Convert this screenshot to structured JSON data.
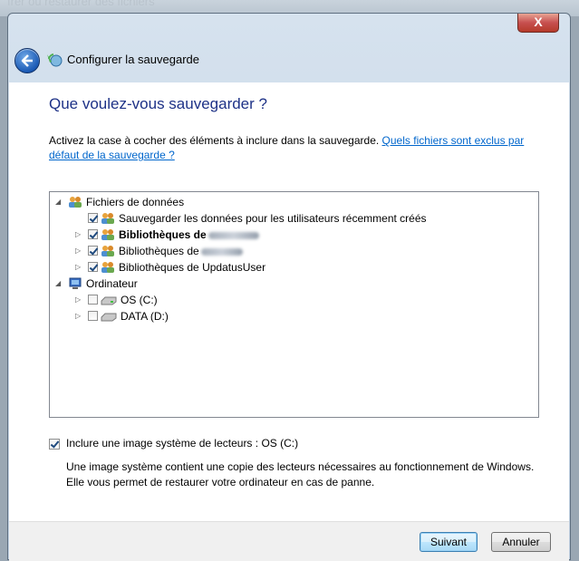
{
  "background": {
    "title_fragment": "ırer ou restaurer des fichiers"
  },
  "window": {
    "title": "Configurer la sauvegarde",
    "close_label": "X",
    "accent": "#1e3287",
    "link_color": "#0066cc"
  },
  "content": {
    "heading": "Que voulez-vous sauvegarder ?",
    "description": "Activez la case à cocher des éléments à inclure dans la sauvegarde.",
    "link_text": "Quels fichiers sont exclus par défaut de la sauvegarde ?"
  },
  "tree": {
    "data_files": {
      "label": "Fichiers de données",
      "icon": "users-icon",
      "expanded": true,
      "children": [
        {
          "label": "Sauvegarder les données pour les utilisateurs récemment créés",
          "checked": true,
          "icon": "users-icon"
        },
        {
          "label": "Bibliothèques de",
          "checked": true,
          "icon": "users-icon",
          "bold": true,
          "redacted": true
        },
        {
          "label": "Bibliothèques de",
          "checked": true,
          "icon": "users-icon",
          "redacted": true
        },
        {
          "label": "Bibliothèques de UpdatusUser",
          "checked": true,
          "icon": "users-icon"
        }
      ]
    },
    "computer": {
      "label": "Ordinateur",
      "icon": "computer-icon",
      "expanded": true,
      "children": [
        {
          "label": "OS (C:)",
          "checked": false,
          "icon": "drive-icon"
        },
        {
          "label": "DATA (D:)",
          "checked": false,
          "icon": "drive-icon"
        }
      ]
    }
  },
  "system_image": {
    "checked": true,
    "label": "Inclure une image système de lecteurs : OS (C:)",
    "description": "Une image système contient une copie des lecteurs nécessaires au fonctionnement de Windows. Elle vous permet de restaurer votre ordinateur en cas de panne."
  },
  "buttons": {
    "next": "Suivant",
    "cancel": "Annuler"
  }
}
